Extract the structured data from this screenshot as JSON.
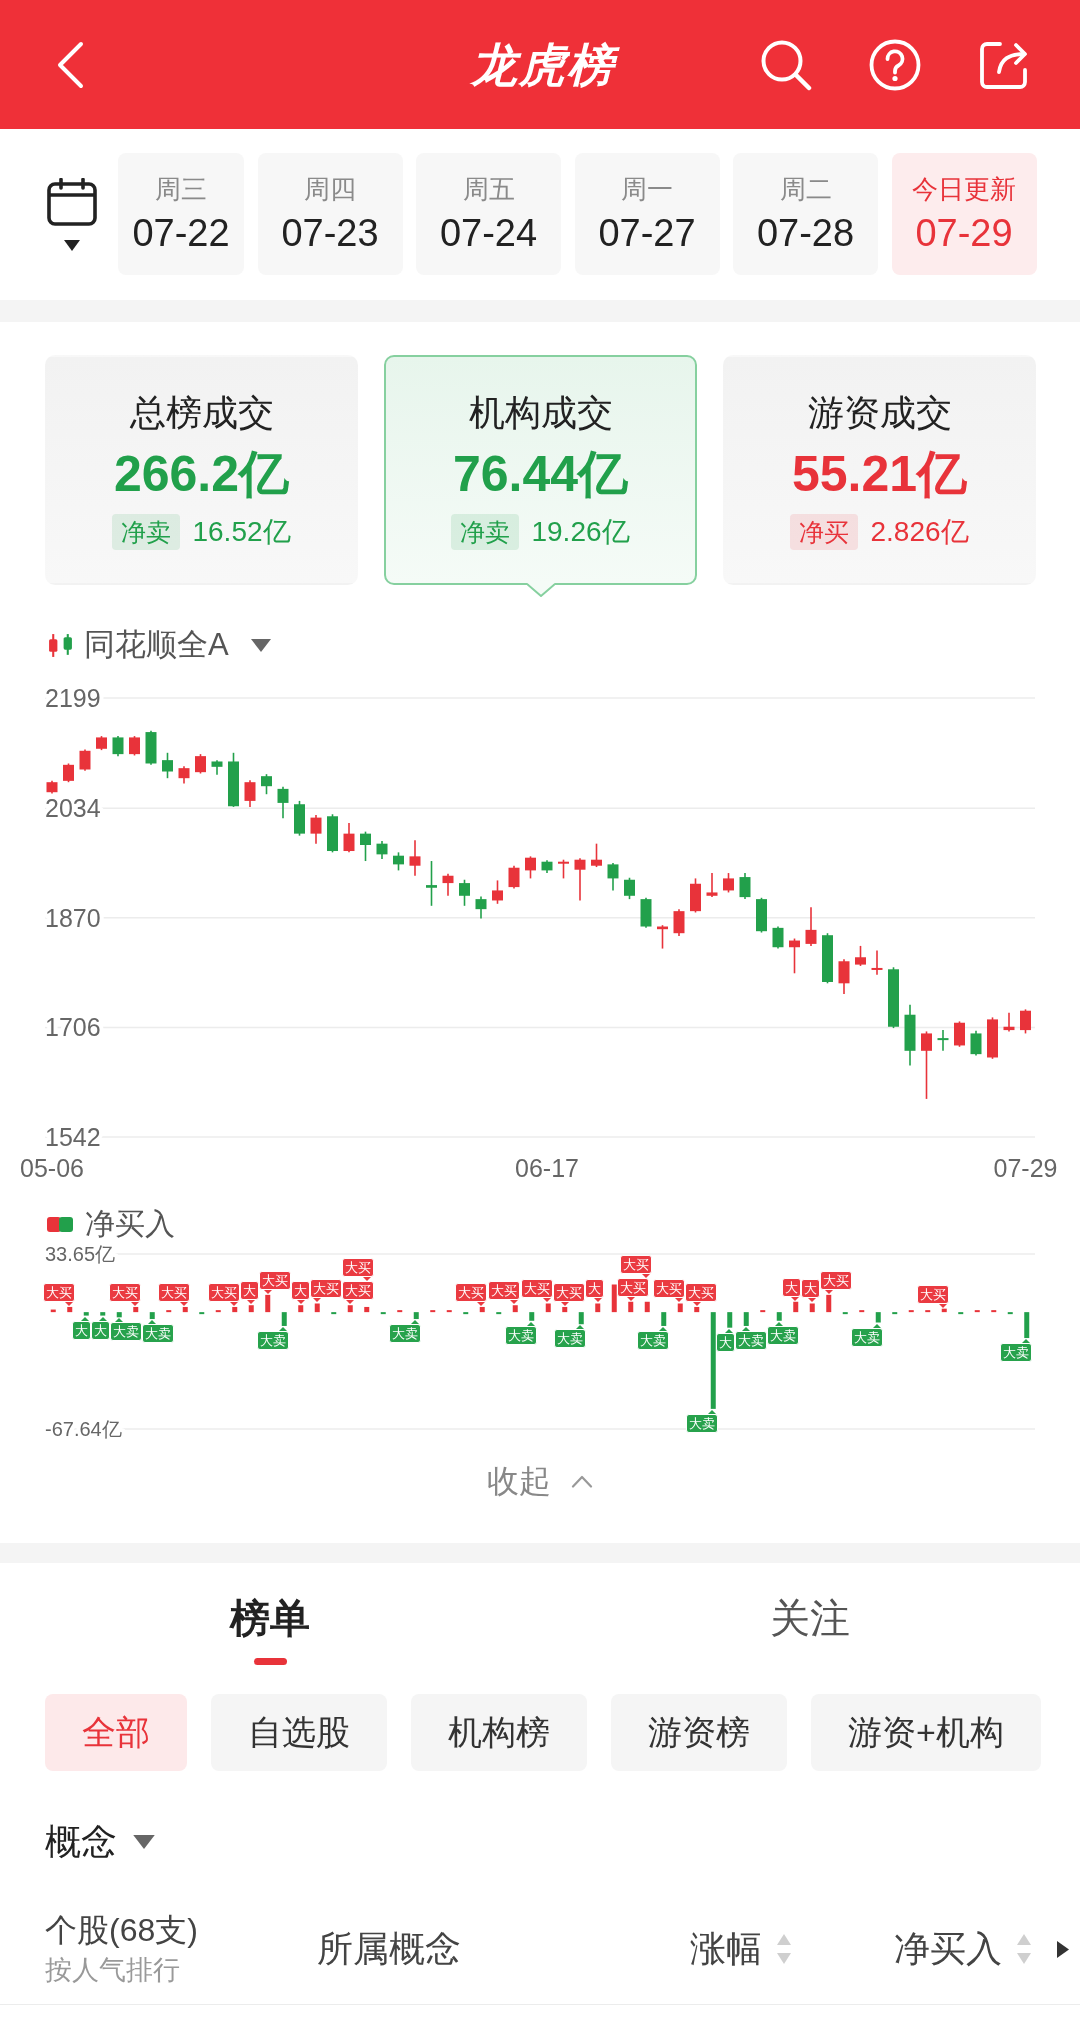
{
  "header": {
    "title": "龙虎榜"
  },
  "dates": [
    {
      "weekday": "周三",
      "date": "07-22",
      "selected": false
    },
    {
      "weekday": "周四",
      "date": "07-23",
      "selected": false
    },
    {
      "weekday": "周五",
      "date": "07-24",
      "selected": false
    },
    {
      "weekday": "周一",
      "date": "07-27",
      "selected": false
    },
    {
      "weekday": "周二",
      "date": "07-28",
      "selected": false
    },
    {
      "weekday": "今日更新",
      "date": "07-29",
      "selected": true
    }
  ],
  "summary_cards": [
    {
      "title": "总榜成交",
      "value": "266.2亿",
      "tag": "净卖",
      "amount": "16.52亿",
      "color": "#21a04b",
      "selected": false
    },
    {
      "title": "机构成交",
      "value": "76.44亿",
      "tag": "净卖",
      "amount": "19.26亿",
      "color": "#21a04b",
      "selected": true
    },
    {
      "title": "游资成交",
      "value": "55.21亿",
      "tag": "净买",
      "amount": "2.826亿",
      "color": "#e8333a",
      "selected": false
    }
  ],
  "index_chart": {
    "selector": "同花顺全A",
    "chart_data": {
      "type": "candlestick",
      "grid": true,
      "categories": [
        "05-06",
        null,
        null,
        null,
        null,
        null,
        null,
        null,
        null,
        null,
        null,
        null,
        null,
        null,
        null,
        null,
        null,
        null,
        null,
        null,
        null,
        null,
        null,
        null,
        null,
        null,
        null,
        null,
        null,
        null,
        "06-17",
        null,
        null,
        null,
        null,
        null,
        null,
        null,
        null,
        null,
        null,
        null,
        null,
        null,
        null,
        null,
        null,
        null,
        null,
        null,
        null,
        null,
        null,
        null,
        null,
        null,
        null,
        null,
        null,
        "07-29"
      ],
      "ohlc": [
        [
          2058,
          2075,
          2056,
          2073
        ],
        [
          2075,
          2101,
          2073,
          2099
        ],
        [
          2092,
          2122,
          2090,
          2120
        ],
        [
          2123,
          2142,
          2121,
          2140
        ],
        [
          2140,
          2142,
          2112,
          2115
        ],
        [
          2115,
          2142,
          2113,
          2140
        ],
        [
          2148,
          2150,
          2099,
          2101
        ],
        [
          2106,
          2117,
          2079,
          2089
        ],
        [
          2079,
          2097,
          2071,
          2094
        ],
        [
          2088,
          2115,
          2086,
          2112
        ],
        [
          2104,
          2106,
          2084,
          2096
        ],
        [
          2104,
          2117,
          2036,
          2037
        ],
        [
          2045,
          2076,
          2036,
          2073
        ],
        [
          2082,
          2085,
          2055,
          2067
        ],
        [
          2063,
          2066,
          2019,
          2042
        ],
        [
          2040,
          2045,
          1993,
          1996
        ],
        [
          1996,
          2024,
          1981,
          2020
        ],
        [
          2022,
          2025,
          1968,
          1970
        ],
        [
          1970,
          2012,
          1968,
          1996
        ],
        [
          1996,
          1999,
          1955,
          1979
        ],
        [
          1981,
          1985,
          1958,
          1965
        ],
        [
          1963,
          1968,
          1941,
          1950
        ],
        [
          1948,
          1986,
          1933,
          1962
        ],
        [
          1919,
          1955,
          1888,
          1915
        ],
        [
          1922,
          1936,
          1903,
          1933
        ],
        [
          1922,
          1927,
          1888,
          1903
        ],
        [
          1898,
          1902,
          1869,
          1883
        ],
        [
          1896,
          1926,
          1891,
          1911
        ],
        [
          1916,
          1948,
          1914,
          1945
        ],
        [
          1941,
          1962,
          1929,
          1960
        ],
        [
          1954,
          1956,
          1937,
          1941
        ],
        [
          1951,
          1957,
          1929,
          1954
        ],
        [
          1942,
          1959,
          1896,
          1957
        ],
        [
          1948,
          1981,
          1946,
          1957
        ],
        [
          1950,
          1952,
          1911,
          1929
        ],
        [
          1927,
          1930,
          1898,
          1903
        ],
        [
          1898,
          1900,
          1855,
          1857
        ],
        [
          1853,
          1859,
          1824,
          1857
        ],
        [
          1847,
          1883,
          1843,
          1880
        ],
        [
          1880,
          1929,
          1878,
          1921
        ],
        [
          1903,
          1937,
          1901,
          1908
        ],
        [
          1911,
          1937,
          1908,
          1929
        ],
        [
          1931,
          1937,
          1898,
          1901
        ],
        [
          1898,
          1900,
          1848,
          1850
        ],
        [
          1855,
          1857,
          1824,
          1826
        ],
        [
          1826,
          1839,
          1787,
          1836
        ],
        [
          1831,
          1886,
          1828,
          1852
        ],
        [
          1844,
          1847,
          1772,
          1774
        ],
        [
          1772,
          1808,
          1756,
          1805
        ],
        [
          1800,
          1828,
          1798,
          1811
        ],
        [
          1792,
          1821,
          1785,
          1795
        ],
        [
          1793,
          1796,
          1705,
          1707
        ],
        [
          1725,
          1740,
          1649,
          1671
        ],
        [
          1671,
          1700,
          1599,
          1697
        ],
        [
          1690,
          1702,
          1671,
          1687
        ],
        [
          1679,
          1715,
          1677,
          1713
        ],
        [
          1697,
          1701,
          1664,
          1666
        ],
        [
          1661,
          1721,
          1659,
          1718
        ],
        [
          1702,
          1728,
          1700,
          1707
        ],
        [
          1702,
          1733,
          1697,
          1731
        ]
      ],
      "ylim": [
        1542,
        2199
      ],
      "yticks": [
        1542,
        1706,
        1870,
        2034,
        2199
      ]
    }
  },
  "net_buy_chart": {
    "chart_data": {
      "type": "bar",
      "title": "净买入",
      "categories": [
        null,
        null,
        null,
        null,
        null,
        null,
        null,
        null,
        null,
        null,
        null,
        null,
        null,
        null,
        null,
        null,
        null,
        null,
        null,
        null,
        null,
        null,
        null,
        null,
        null,
        null,
        null,
        null,
        null,
        null,
        null,
        null,
        null,
        null,
        null,
        null,
        null,
        null,
        null,
        null,
        null,
        null,
        null,
        null,
        null,
        null,
        null,
        null,
        null,
        null,
        null,
        null,
        null,
        null,
        null,
        null,
        null,
        null,
        null,
        null
      ],
      "values": [
        1.5,
        3,
        -2,
        -2,
        -3,
        3,
        -4,
        0.5,
        3,
        -1,
        1,
        3,
        4,
        10,
        -8,
        4,
        5,
        -1,
        4,
        3,
        -1,
        0.3,
        -4,
        0.3,
        0.5,
        -1,
        3,
        -1,
        4,
        -5,
        5,
        3,
        -7,
        5,
        16,
        6,
        6,
        -8,
        5,
        3,
        -56,
        -9,
        -8,
        0.5,
        -5,
        6,
        5,
        10,
        -1,
        1,
        -6,
        -1,
        0.5,
        0.3,
        2,
        -1,
        0.3,
        0.5,
        -1,
        -15
      ],
      "ylim": [
        -67.64,
        33.65
      ],
      "yticks": [
        {
          "value": 33.65,
          "label": "33.65亿"
        },
        {
          "value": -67.64,
          "label": "-67.64亿"
        }
      ],
      "value_labels": [
        null,
        "大买",
        "大",
        "大",
        "大卖",
        "大买",
        "大卖",
        null,
        "大买",
        null,
        null,
        "大买",
        "大",
        "大买",
        "大卖",
        "大",
        "大买",
        null,
        "大买",
        "大买",
        null,
        null,
        "大卖",
        null,
        null,
        null,
        "大买",
        null,
        "大买",
        "大卖",
        "大买",
        "大买",
        "大卖",
        "大",
        null,
        "大买",
        "大买",
        "大卖",
        "大买",
        "大买",
        "大卖",
        "大",
        "大卖",
        null,
        "大卖",
        "大",
        "大",
        "大买",
        null,
        null,
        "大卖",
        null,
        null,
        null,
        "大买",
        null,
        null,
        null,
        null,
        "大卖"
      ]
    }
  },
  "collapse_button": {
    "label": "收起"
  },
  "tabs": [
    {
      "label": "榜单",
      "selected": true
    },
    {
      "label": "关注",
      "selected": false
    }
  ],
  "filters": [
    {
      "label": "全部",
      "selected": true
    },
    {
      "label": "自选股",
      "selected": false
    },
    {
      "label": "机构榜",
      "selected": false
    },
    {
      "label": "游资榜",
      "selected": false
    },
    {
      "label": "游资+机构",
      "selected": false
    }
  ],
  "category_filter": {
    "label": "概念"
  },
  "table": {
    "columns": [
      {
        "label": "个股(68支)",
        "sublabel": "按人气排行",
        "sortable": false
      },
      {
        "label": "所属概念",
        "sortable": false
      },
      {
        "label": "涨幅",
        "sortable": true
      },
      {
        "label": "净买入",
        "sortable": true
      }
    ]
  }
}
